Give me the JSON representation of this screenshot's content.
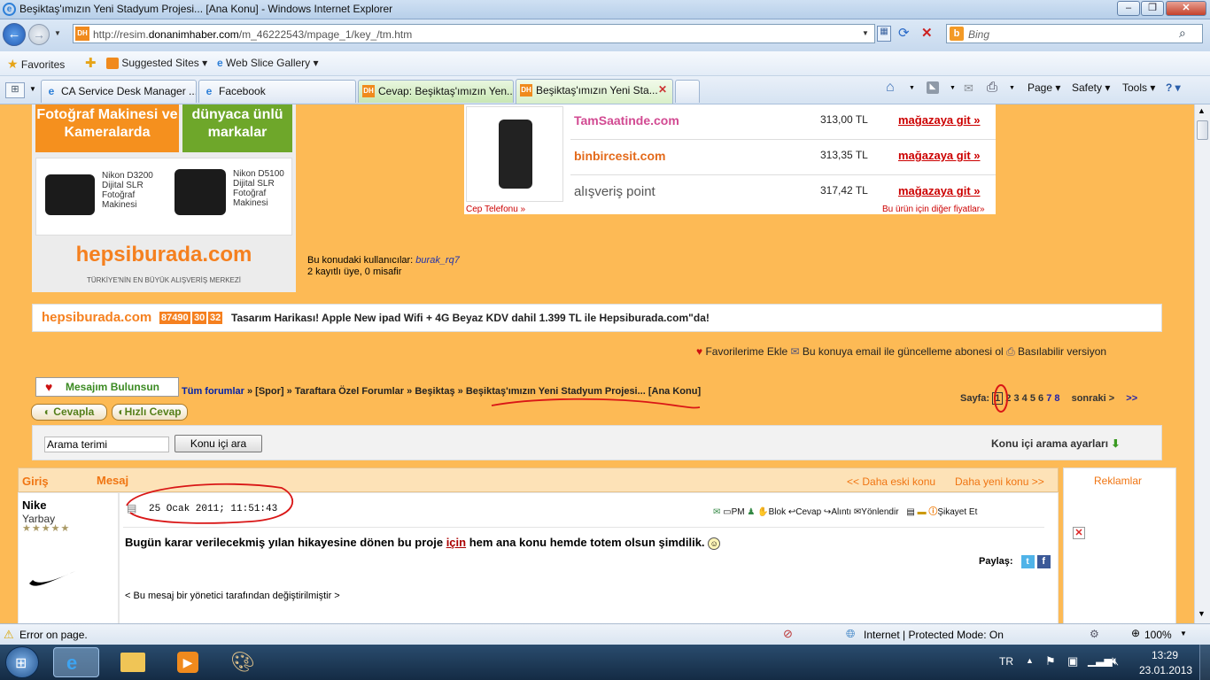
{
  "window": {
    "title": "Beşiktaş'ımızın Yeni Stadyum Projesi... [Ana Konu] - Windows Internet Explorer",
    "min_label": "–",
    "max_label": "❐",
    "close_label": "✕"
  },
  "address": {
    "url_prefix": "http://resim.",
    "url_domain": "donanimhaber.com",
    "url_rest": "/m_46222543/mpage_1/key_/tm.htm",
    "search_placeholder": "Bing"
  },
  "favorites_bar": {
    "favorites_label": "Favorites",
    "suggested_label": "Suggested Sites ▾",
    "webslice_label": "Web Slice Gallery ▾"
  },
  "tabs": [
    {
      "label": "CA Service Desk Manager ..."
    },
    {
      "label": "Facebook"
    },
    {
      "label": "Cevap: Beşiktaş'ımızın Yen..."
    },
    {
      "label": "Beşiktaş'ımızın Yeni Sta..."
    }
  ],
  "command_bar": {
    "page_label": "Page ▾",
    "safety_label": "Safety ▾",
    "tools_label": "Tools ▾",
    "help_label": "? ▾"
  },
  "ad_camera": {
    "top_left_text": "Fotoğraf Makinesi ve Kameralarda",
    "top_right_text": "dünyaca ünlü markalar",
    "cam1_text": "Nikon D3200 Dijital SLR Fotoğraf Makinesi",
    "cam2_text": "Nikon D5100 Dijital SLR Fotoğraf Makinesi",
    "brand": "hepsiburada.com",
    "tagline": "TÜRKİYE'NİN EN BÜYÜK ALIŞVERİŞ MERKEZİ"
  },
  "price_ad": {
    "rows": [
      {
        "store": "TamSaatinde.com",
        "price": "313,00 TL",
        "cta": "mağazaya git »"
      },
      {
        "store": "binbircesit.com",
        "price": "313,35 TL",
        "cta": "mağazaya git »"
      },
      {
        "store": "alışveriş point",
        "price": "317,42 TL",
        "cta": "mağazaya git »"
      }
    ],
    "category_link": "Cep Telefonu »",
    "other_prices": "Bu ürün için diğer fiyatlar»"
  },
  "users": {
    "label": "Bu konudaki kullanıcılar:",
    "user": "burak_rq7",
    "count_text": "2 kayıtlı üye, 0 misafir"
  },
  "banner": {
    "brand": "hepsiburada.com",
    "timer_1": "87490",
    "timer_2": "30",
    "timer_3": "32",
    "text": "Tasarım Harikası! Apple New ipad Wifi + 4G Beyaz KDV dahil 1.399 TL ile Hepsiburada.com\"da!"
  },
  "topic_tools": {
    "fav": "Favorilerime Ekle",
    "email": "Bu konuya email ile güncelleme abonesi ol",
    "print": "Basılabilir versiyon"
  },
  "breadcrumb": {
    "msg_label": "Mesajım Bulunsun",
    "items": [
      "Tüm forumlar",
      "[Spor]",
      "Taraftara Özel Forumlar",
      "Beşiktaş"
    ],
    "sep": "»",
    "current": "Beşiktaş'ımızın Yeni Stadyum Projesi... [Ana Konu]"
  },
  "buttons": {
    "reply": "Cevapla",
    "quick_reply": "Hızlı Cevap"
  },
  "pagination": {
    "label": "Sayfa:",
    "current": "1",
    "pages": [
      "2",
      "3",
      "4",
      "5",
      "6",
      "7",
      "8"
    ],
    "next": "sonraki >",
    "last": ">>"
  },
  "search": {
    "input_value": "Arama terimi",
    "button": "Konu içi ara",
    "settings": "Konu içi arama ayarları"
  },
  "post_header": {
    "col_user": "Giriş",
    "col_msg": "Mesaj",
    "older": "<< Daha eski konu",
    "newer": "Daha yeni konu >>",
    "ads": "Reklamlar"
  },
  "post": {
    "author": "Nike",
    "rank": "Yarbay",
    "stars": "★★★★★",
    "date": "25 Ocak 2011; 11:51:43",
    "actions": [
      "PM",
      "Blok",
      "Cevap",
      "Alıntı",
      "Yönlendir",
      "Şikayet Et"
    ],
    "body_before": "Bugün karar verilecekmiş yılan hikayesine dönen bu proje ",
    "body_link": "için",
    "body_after": " hem ana konu hemde totem olsun şimdilik.",
    "share": "Paylaş:",
    "edit_note": "< Bu mesaj bir yönetici tarafından değiştirilmiştir >"
  },
  "status": {
    "left": "Error on page.",
    "zone": "Internet | Protected Mode: On",
    "zoom": "100%"
  },
  "taskbar": {
    "lang": "TR",
    "time": "13:29",
    "date": "23.01.2013"
  }
}
